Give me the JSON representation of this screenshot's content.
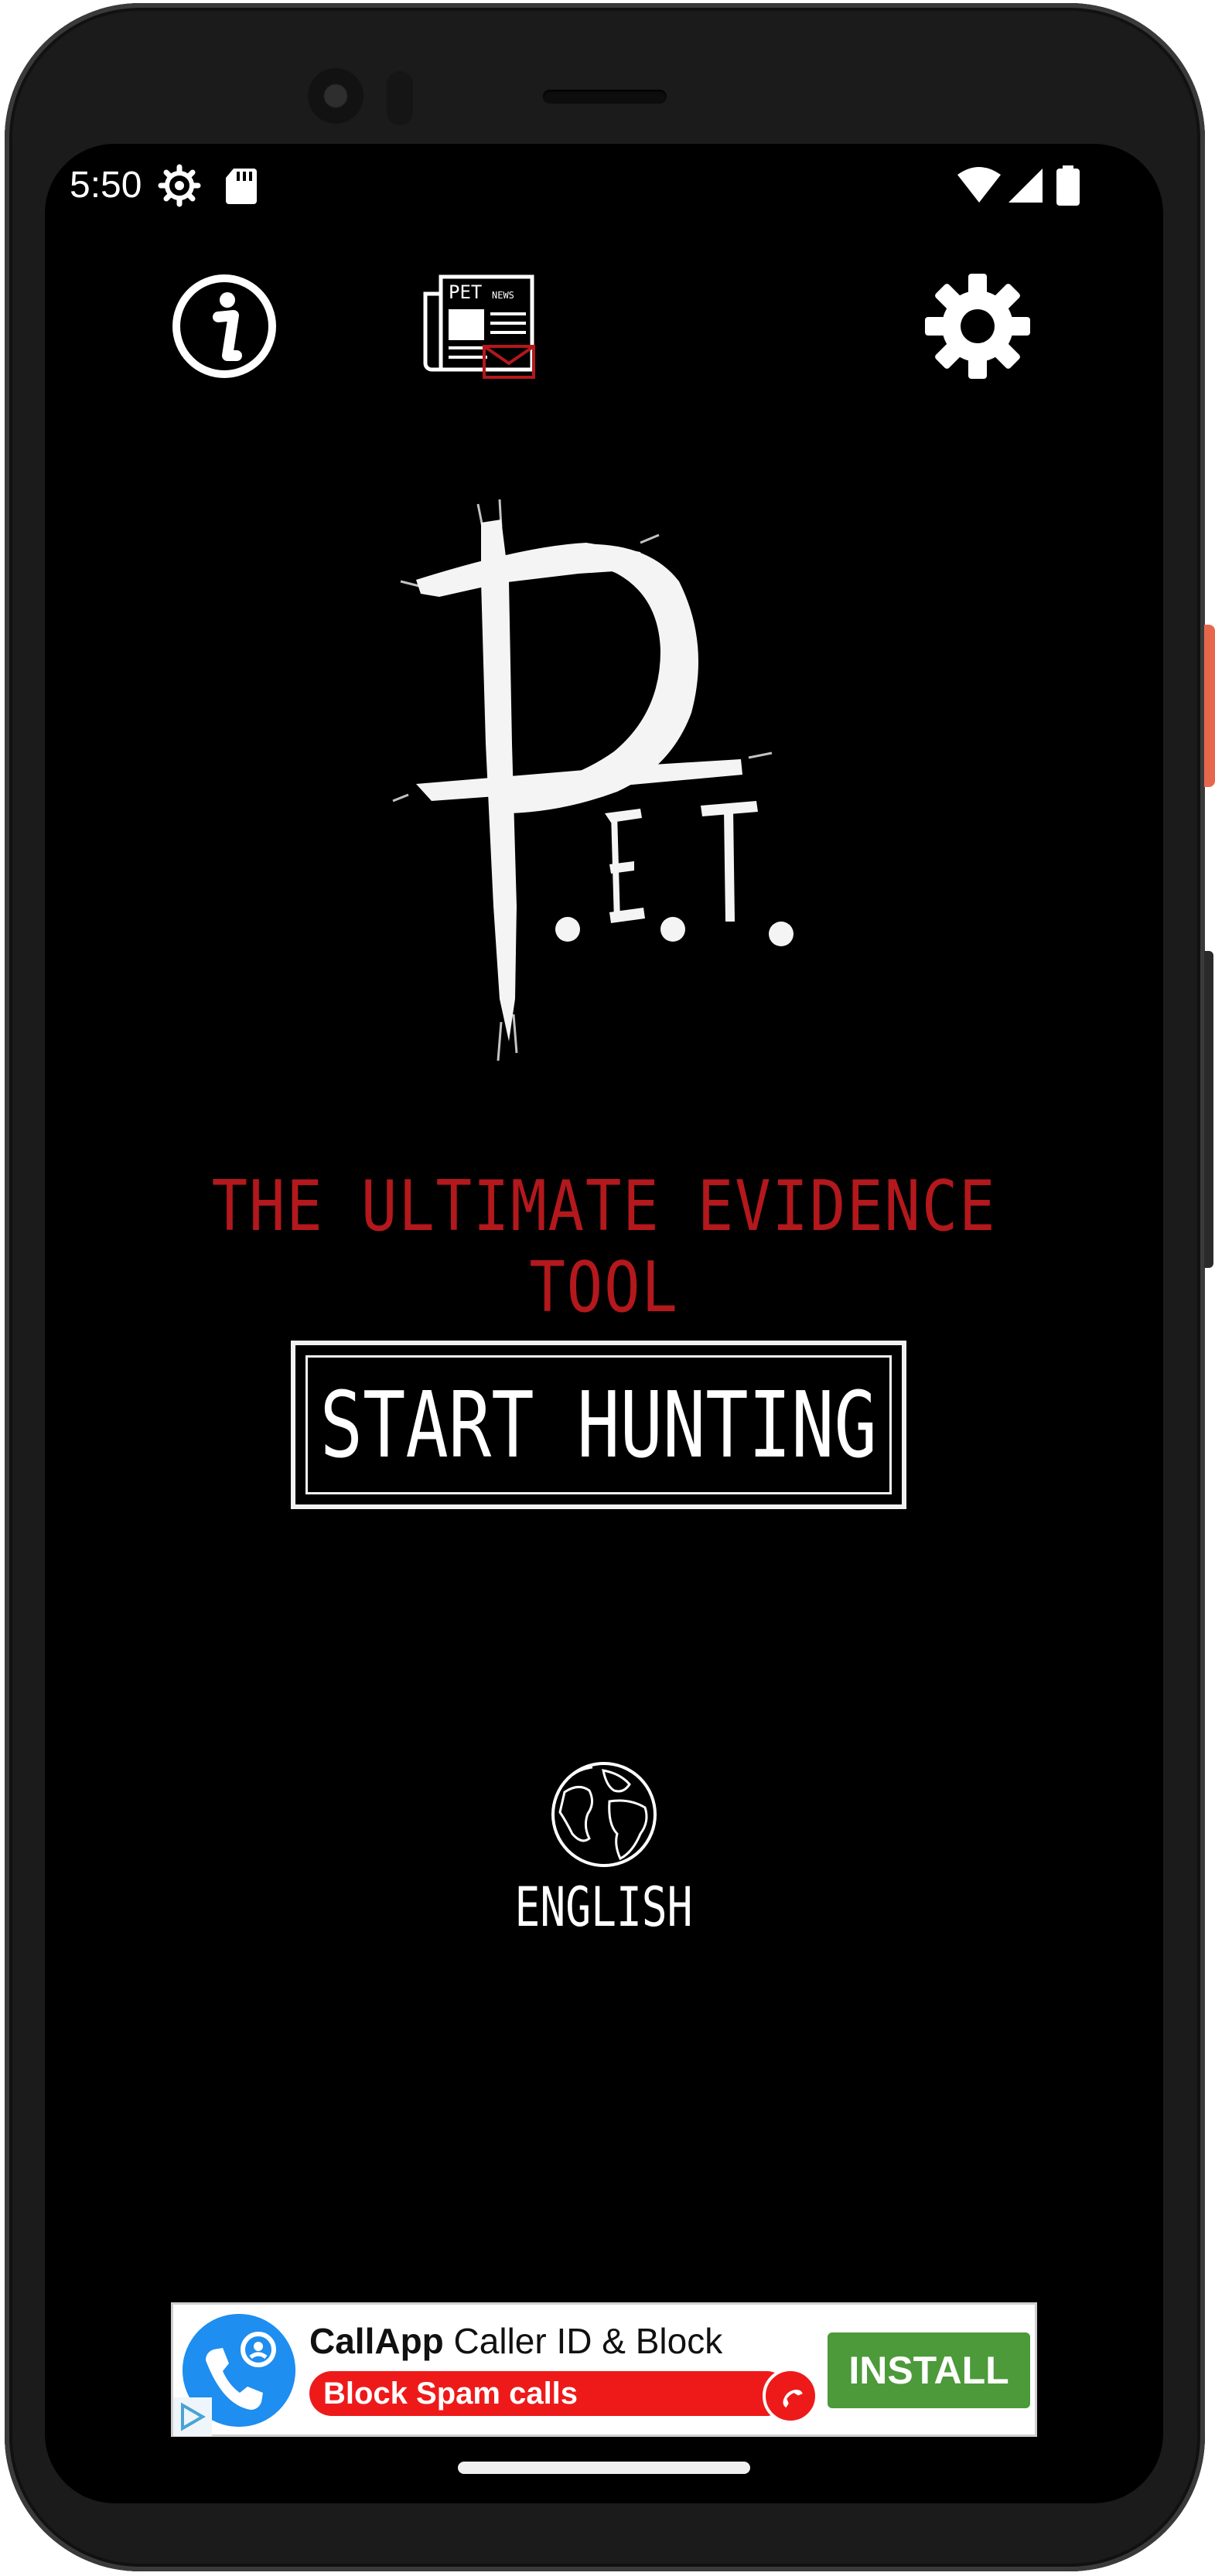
{
  "status_bar": {
    "time": "5:50",
    "left_icons": [
      "settings-gear-icon",
      "sd-card-icon"
    ],
    "right_icons": [
      "wifi-icon",
      "cell-signal-icon",
      "battery-icon"
    ]
  },
  "top_bar": {
    "icons": [
      "info-icon",
      "newspaper-icon",
      "settings-icon"
    ],
    "news_icon_text": "PET",
    "news_icon_subtext": "NEWS"
  },
  "logo": {
    "text": "P.E.T."
  },
  "tagline": "THE ULTIMATE EVIDENCE TOOL",
  "start_button": {
    "label": "START HUNTING"
  },
  "language": {
    "icon": "globe-icon",
    "label": "ENGLISH"
  },
  "ad": {
    "app_name": "CallApp",
    "title_rest": " Caller ID & Block",
    "subtitle": "Block Spam calls",
    "cta": "INSTALL",
    "colors": {
      "cta": "#4c9a3a",
      "subtitle_bg": "#ee1a1a",
      "icon_bg": "#1e8ef0"
    }
  },
  "colors": {
    "background": "#000000",
    "tagline": "#b3181c",
    "text": "#ffffff"
  }
}
